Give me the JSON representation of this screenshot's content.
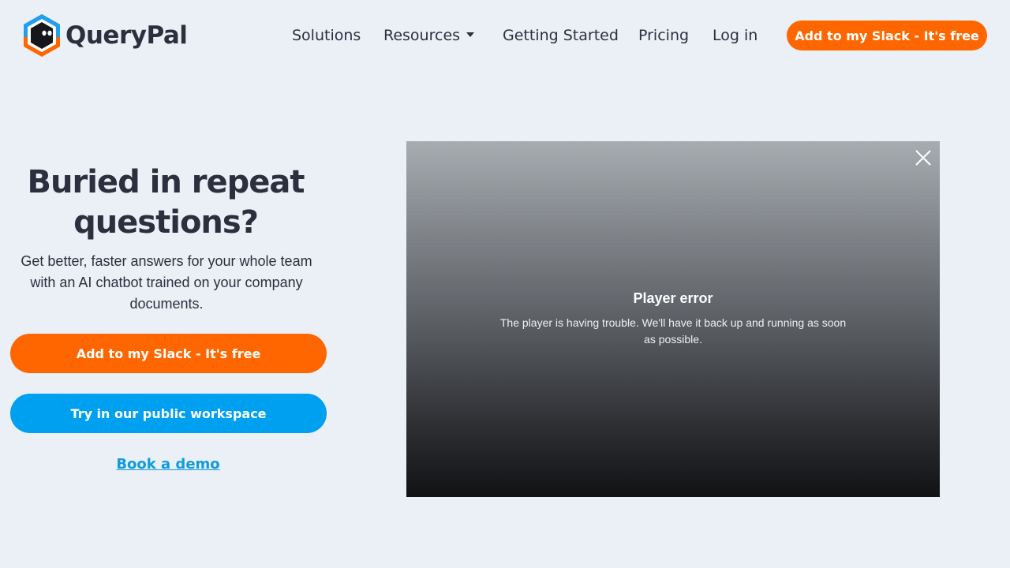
{
  "header": {
    "brand": "QueryPal",
    "nav": {
      "solutions": "Solutions",
      "resources": "Resources",
      "getting_started": "Getting Started",
      "pricing": "Pricing",
      "login": "Log in"
    },
    "cta": "Add to my Slack - It's free"
  },
  "hero": {
    "title_line1": "Buried in repeat",
    "title_line2": "questions?",
    "subtitle": "Get better, faster answers for your whole team with an AI chatbot trained on your company documents.",
    "primary_button": "Add to my Slack - It's free",
    "secondary_button": "Try in our public workspace",
    "demo_link": "Book a demo"
  },
  "player": {
    "error_title": "Player error",
    "error_message": "The player is having trouble. We'll have it back up and running as soon as possible."
  },
  "colors": {
    "background": "#ebf0f6",
    "accent_orange": "#ff6600",
    "accent_blue": "#00a0f0",
    "text_dark": "#2c2f3e",
    "link_blue": "#0f9be0"
  },
  "icons": {
    "logo": "hexagon-bot-logo-icon",
    "resources_caret": "caret-down-icon",
    "player_close": "close-icon"
  }
}
